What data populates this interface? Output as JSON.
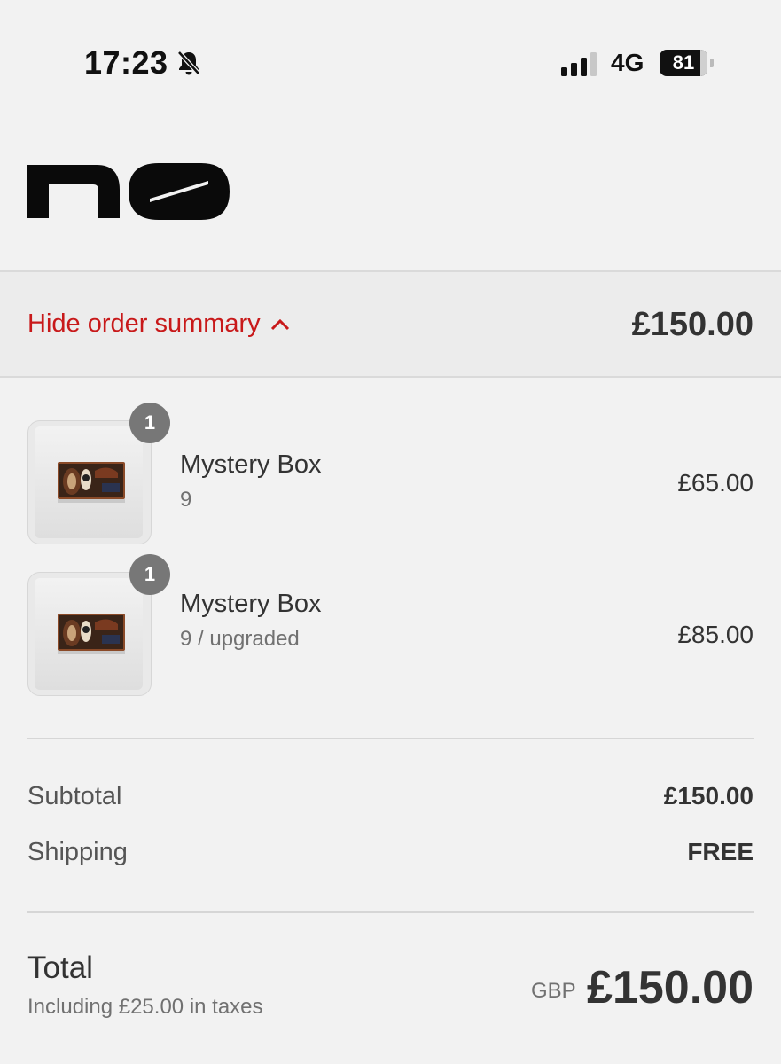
{
  "status_bar": {
    "time": "17:23",
    "network": "4G",
    "battery": "81"
  },
  "summary_toggle": {
    "label": "Hide order summary",
    "total": "£150.00"
  },
  "line_items": [
    {
      "quantity": "1",
      "name": "Mystery Box",
      "variant": "9",
      "price": "£65.00"
    },
    {
      "quantity": "1",
      "name": "Mystery Box",
      "variant": "9 / upgraded",
      "price": "£85.00"
    }
  ],
  "costs": {
    "subtotal_label": "Subtotal",
    "subtotal_value": "£150.00",
    "shipping_label": "Shipping",
    "shipping_value": "FREE"
  },
  "total": {
    "label": "Total",
    "tax_note": "Including £25.00 in taxes",
    "currency": "GBP",
    "amount": "£150.00"
  },
  "colors": {
    "accent": "#c8191a",
    "background": "#f2f2f2"
  }
}
